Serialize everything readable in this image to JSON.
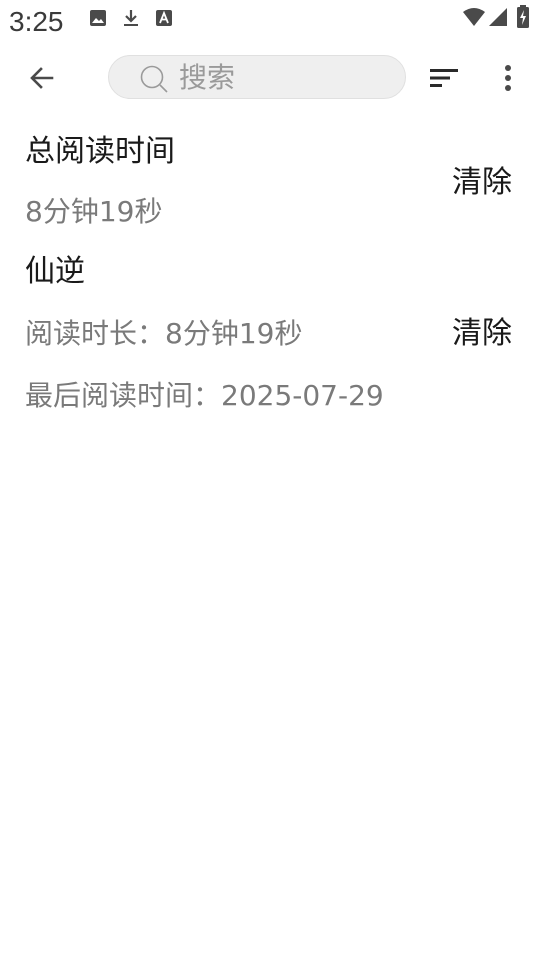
{
  "status_bar": {
    "time": "3:25",
    "icons": [
      "image-icon",
      "download-icon",
      "font-icon",
      "wifi-icon",
      "signal-icon",
      "battery-charging-icon"
    ]
  },
  "toolbar": {
    "back_icon": "arrow-back-icon",
    "search_placeholder": "搜索",
    "search_value": "",
    "sort_icon": "sort-icon",
    "more_icon": "more-vert-icon"
  },
  "total": {
    "title": "总阅读时间",
    "value": "8分钟19秒",
    "clear_label": "清除"
  },
  "books": [
    {
      "title": "仙逆",
      "duration": "阅读时长：8分钟19秒",
      "last_read": "最后阅读时间：2025-07-29",
      "clear_label": "清除"
    }
  ],
  "colors": {
    "background": "#ffffff",
    "primary_text": "#1a1a1a",
    "secondary_text": "#7a7a7a",
    "search_bg": "#efefef",
    "icon": "#4a4a4a"
  }
}
